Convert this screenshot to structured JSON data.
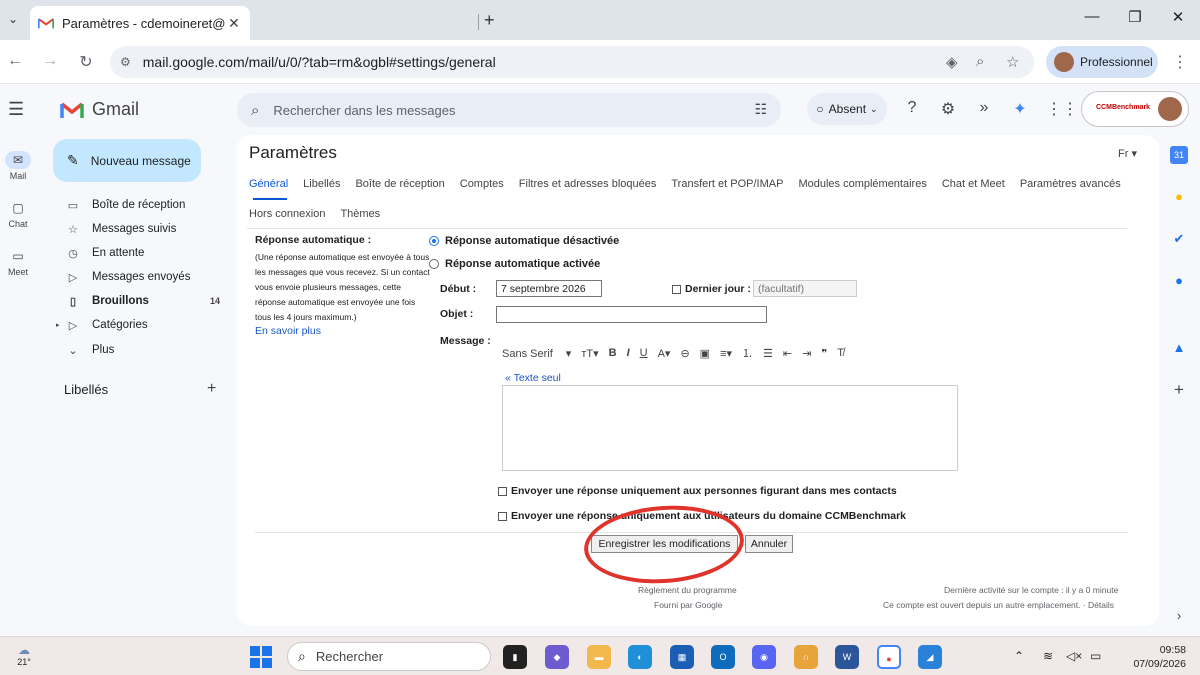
{
  "browser": {
    "tab_title": "Paramètres - cdemoineret@phc",
    "url_site_icon": "site-settings-icon",
    "url": "mail.google.com/mail/u/0/?tab=rm&ogbl#settings/general",
    "profile_label": "Professionnel",
    "new_tab": "+",
    "tab_close": "✕"
  },
  "gmail": {
    "product_name": "Gmail",
    "search_placeholder": "Rechercher dans les messages",
    "status_label": "Absent",
    "compose_label": "Nouveau message",
    "brand_badge": "CCMBenchmark"
  },
  "rail": {
    "mail": "Mail",
    "chat": "Chat",
    "meet": "Meet"
  },
  "nav": [
    {
      "label": "Boîte de réception",
      "icon": "inbox-icon"
    },
    {
      "label": "Messages suivis",
      "icon": "star-icon"
    },
    {
      "label": "En attente",
      "icon": "clock-icon"
    },
    {
      "label": "Messages envoyés",
      "icon": "send-icon"
    },
    {
      "label": "Brouillons",
      "icon": "draft-icon",
      "count": "14",
      "bold": true
    },
    {
      "label": "Catégories",
      "icon": "label-icon"
    },
    {
      "label": "Plus",
      "icon": "chevron-down-icon"
    }
  ],
  "labels_heading": "Libellés",
  "settings": {
    "title": "Paramètres",
    "lang": "Fr",
    "tabs": [
      "Général",
      "Libellés",
      "Boîte de réception",
      "Comptes",
      "Filtres et adresses bloquées",
      "Transfert et POP/IMAP",
      "Modules complémentaires",
      "Chat et Meet",
      "Paramètres avancés"
    ],
    "tabs_row2": [
      "Hors connexion",
      "Thèmes"
    ],
    "auto_reply": {
      "label": "Réponse automatique :",
      "description": "(Une réponse automatique est envoyée à tous les messages que vous recevez. Si un contact vous envoie plusieurs messages, cette réponse automatique est envoyée une fois tous les 4 jours maximum.)",
      "learn_more": "En savoir plus",
      "option_off": "Réponse automatique désactivée",
      "option_on": "Réponse automatique activée",
      "start_label": "Début :",
      "start_value": "7 septembre 2026",
      "last_day_label": "Dernier jour :",
      "last_day_placeholder": "(facultatif)",
      "subject_label": "Objet :",
      "subject_value": "",
      "message_label": "Message :",
      "font_name": "Sans Serif",
      "plain_text_link": "« Texte seul",
      "contacts_only": "Envoyer une réponse uniquement aux personnes figurant dans mes contacts",
      "domain_only": "Envoyer une réponse uniquement aux utilisateurs du domaine CCMBenchmark",
      "selected_option": "off"
    },
    "save_button": "Enregistrer les modifications",
    "cancel_button": "Annuler",
    "footer": {
      "program_policies": "Règlement du programme",
      "powered_by": "Fourni par Google",
      "last_activity": "Dernière activité sur le compte : il y a 0 minute",
      "open_elsewhere": "Ce compte est ouvert depuis un autre emplacement. · Détails"
    }
  },
  "taskbar": {
    "temperature": "21°",
    "search_placeholder": "Rechercher",
    "time": "09:58",
    "date": "07/09/2026"
  },
  "colors": {
    "accent": "#0b57d0",
    "compose_bg": "#c2e7ff",
    "annotation": "#e0342b",
    "gmail_bg": "#f6f8fc"
  }
}
